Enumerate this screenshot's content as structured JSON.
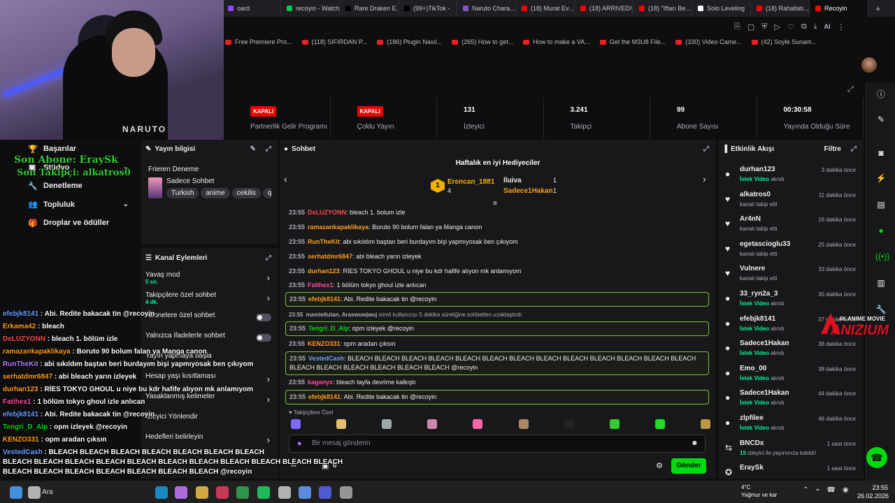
{
  "browser": {
    "tabs": [
      {
        "label": "oard",
        "color": "#9147ff"
      },
      {
        "label": "recoyin - Watch",
        "color": "#00c853"
      },
      {
        "label": "Rare Draken E...",
        "color": "#000000"
      },
      {
        "label": "(99+)TikTok -",
        "color": "#000000"
      },
      {
        "label": "Naruto Chara...",
        "color": "#7e57c2"
      },
      {
        "label": "(18) Murat Ev...",
        "color": "#ff0000"
      },
      {
        "label": "(18) ARRIVED!...",
        "color": "#ff0000"
      },
      {
        "label": "(18) \"Iftarı Be...",
        "color": "#ff0000"
      },
      {
        "label": "Solo Leveling",
        "color": "#ffffff"
      },
      {
        "label": "(18) Rahatlatı...",
        "color": "#ff0000"
      },
      {
        "label": "Recoyin",
        "color": "#ff0000",
        "active": true
      }
    ],
    "bookmarks": [
      "Free Premiere Pro...",
      "(118) SIFIRDAN P...",
      "(186) Plugin Nasıl...",
      "(265) How to get...",
      "How to make a VA...",
      "Get the M3U8 File...",
      "(330) Video Came...",
      "(42) Soyle Sunam..."
    ],
    "ai_label": "AI"
  },
  "stats": [
    {
      "value": "KAPALI",
      "label": "Partnerlik Gelir Programı",
      "badge": true
    },
    {
      "value": "KAPALI",
      "label": "Çoklu Yayın",
      "badge": true
    },
    {
      "value": "131",
      "label": "İzleyici"
    },
    {
      "value": "3.241",
      "label": "Takipçi"
    },
    {
      "value": "99",
      "label": "Abone Sayısı"
    },
    {
      "value": "00:30:58",
      "label": "Yayında Olduğu Süre"
    }
  ],
  "webcam": {
    "shirt_text": "NARUTO"
  },
  "leftnav": {
    "items": [
      {
        "label": "Başarılar",
        "icon": "trophy-icon",
        "glyph": "🏆"
      },
      {
        "label": "Stüdyo",
        "icon": "studio-icon",
        "glyph": "▣",
        "chev": true
      },
      {
        "label": "Denetleme",
        "icon": "wrench-icon",
        "glyph": "🔧"
      },
      {
        "label": "Topluluk",
        "icon": "users-icon",
        "glyph": "👥",
        "chev": true
      },
      {
        "label": "Droplar ve ödüller",
        "icon": "gift-icon",
        "glyph": "🎁"
      }
    ],
    "overlay_sub": "Son Abone: EraySk",
    "overlay_follow": "Son Takipçi: alkatros0"
  },
  "streaminfo": {
    "header": "Yayın bilgisi",
    "title": "Frieren Deneme",
    "category": "Sadece Sohbet",
    "tags": [
      "Turkish",
      "anime",
      "cekilis",
      "q"
    ]
  },
  "actions": {
    "header": "Kanal Eylemleri",
    "items": [
      {
        "label": "Yavaş mod",
        "sub": "5 sn.",
        "kind": "arrow"
      },
      {
        "label": "Takipçilere özel sohbet",
        "sub": "4 dk.",
        "kind": "arrow"
      },
      {
        "label": "Abonelere özel sohbet",
        "sub": "",
        "kind": "toggle"
      },
      {
        "label": "Yalnızca ifadelerle sohbet",
        "sub": "",
        "kind": "toggle"
      },
      {
        "label": "Yayın yapmaya başla",
        "sub": "",
        "kind": "none"
      },
      {
        "label": "Hesap yaşı kısıtlaması",
        "sub": "",
        "kind": "arrow"
      },
      {
        "label": "Yasaklanmış kelimeler",
        "sub": "",
        "kind": "arrow"
      },
      {
        "label": "İzleyici Yönlendir",
        "sub": "",
        "kind": "none"
      },
      {
        "label": "Hedefleri belirleyin",
        "sub": "",
        "kind": "arrow"
      }
    ]
  },
  "chat": {
    "header": "Sohbet",
    "gifters_title": "Haftalık en iyi Hediyeciler",
    "gifter1": {
      "rank": "1",
      "name": "Erencan_1881",
      "count": "4"
    },
    "gifter2": {
      "name": "lluiva",
      "count": "1"
    },
    "gifter3": {
      "name": "Sadece1Hakan",
      "count": "1"
    },
    "messages": [
      {
        "time": "23:55",
        "user": "DeLUZYONN",
        "color": "#ff4a4a",
        "text": ": bleach 1. bolum izle",
        "hl": false
      },
      {
        "time": "23:55",
        "user": "ramazankapaklikaya",
        "color": "#ff9f1a",
        "text": ": Boruto 90 bolum falan ya Manga canon",
        "hl": false
      },
      {
        "time": "23:55",
        "user": "RunTheKit",
        "color": "#ff9f1a",
        "text": ": abi sıkıldım baştan beri burdayım bişi yapmıyosak ben çıkıyom",
        "hl": false
      },
      {
        "time": "23:55",
        "user": "serhatdmr6847",
        "color": "#ff9f1a",
        "text": ": abi bleach yarın izleyek",
        "hl": false
      },
      {
        "time": "23:55",
        "user": "durhan123",
        "color": "#ff9f1a",
        "text": ": RİES TOKYO GHOUL u niye bu kdr hafife alıyon mk anlamıyom",
        "hl": false
      },
      {
        "time": "23:55",
        "user": "Fatihex1",
        "color": "#ff4a9a",
        "text": ": 1 bölüm tokyo ghoul izle anlıcan",
        "hl": false
      },
      {
        "time": "23:55",
        "user": "efebjk8141",
        "color": "#ff9f1a",
        "text": ": Abi. Redite bakacak tin @recoyin",
        "hl": true
      },
      {
        "time": "23:55",
        "user": "mamieltutan, Araswuwjwuj",
        "color": "#adadb8",
        "text": " isimli kullanıcıyı 5 dakika süreliğine sohbetten uzaklaştırdı",
        "hl": false
      },
      {
        "time": "23:55",
        "user": "Tengri_D_Alp",
        "color": "#00db10",
        "text": ": opm izleyek @recoyin",
        "hl": true
      },
      {
        "time": "23:55",
        "user": "KENZO331",
        "color": "#ff9f1a",
        "text": ": opm aradan çıksın",
        "hl": false
      },
      {
        "time": "23:55",
        "user": "VestedCash",
        "color": "#6a9fff",
        "text": ": BLEACH BLEACH BLEACH BLEACH BLEACH BLEACH BLEACH BLEACH BLEACH BLEACH BLEACH BLEACH BLEACH BLEACH BLEACH BLEACH BLEACH BLEACH BLEACH @recoyin",
        "hl": true
      },
      {
        "time": "23:55",
        "user": "kaganyx",
        "color": "#ff4a9a",
        "text": ": bleach tayfa devrime kalkıştı",
        "hl": false
      },
      {
        "time": "23:55",
        "user": "efebjk8141",
        "color": "#ff9f1a",
        "text": ": Abi. Redite bakacak tin @recoyin",
        "hl": true
      }
    ],
    "followers_only": "Takipçilere Özel",
    "input_placeholder": "Bir mesaj gönderin",
    "points": "0",
    "send_label": "Gönder"
  },
  "feed": {
    "header": "Etkinlik Akışı",
    "filter": "Filtre",
    "events": [
      {
        "name": "durhan123",
        "desc_pre": "",
        "desc_hl": "İstek Video",
        "desc_post": " alındı",
        "time": "3 dakika önce",
        "icon": "●"
      },
      {
        "name": "alkatros0",
        "desc_pre": "kanalı takip etti",
        "desc_hl": "",
        "desc_post": "",
        "time": "11 dakika önce",
        "icon": "♥"
      },
      {
        "name": "Ar4nN",
        "desc_pre": "kanalı takip etti",
        "desc_hl": "",
        "desc_post": "",
        "time": "16 dakika önce",
        "icon": "♥"
      },
      {
        "name": "egetascioglu33",
        "desc_pre": "kanalı takip etti",
        "desc_hl": "",
        "desc_post": "",
        "time": "25 dakika önce",
        "icon": "♥"
      },
      {
        "name": "Vulnere",
        "desc_pre": "kanalı takip etti",
        "desc_hl": "",
        "desc_post": "",
        "time": "33 dakika önce",
        "icon": "♥"
      },
      {
        "name": "33_ryn2a_3",
        "desc_pre": "",
        "desc_hl": "İstek Video",
        "desc_post": " alındı",
        "time": "35 dakika önce",
        "icon": "●"
      },
      {
        "name": "efebjk8141",
        "desc_pre": "",
        "desc_hl": "İstek Video",
        "desc_post": " alındı",
        "time": "37 dakika önce",
        "icon": "●"
      },
      {
        "name": "Sadece1Hakan",
        "desc_pre": "",
        "desc_hl": "İstek Video",
        "desc_post": " alındı",
        "time": "38 dakika önce",
        "icon": "●"
      },
      {
        "name": "Emo_00",
        "desc_pre": "",
        "desc_hl": "İstek Video",
        "desc_post": " alındı",
        "time": "38 dakika önce",
        "icon": "●"
      },
      {
        "name": "Sadece1Hakan",
        "desc_pre": "",
        "desc_hl": "İstek Video",
        "desc_post": " alındı",
        "time": "44 dakika önce",
        "icon": "●"
      },
      {
        "name": "zlpfilee",
        "desc_pre": "",
        "desc_hl": "İstek Video",
        "desc_post": " alındı",
        "time": "46 dakika önce",
        "icon": "●"
      },
      {
        "name": "BNCDx",
        "desc_pre": "",
        "desc_hl": "19",
        "desc_post": " izleyici ile yayınınıza katıldı!",
        "time": "1 saat önce",
        "icon": "⇆"
      },
      {
        "name": "EraySk",
        "desc_pre": "",
        "desc_hl": "",
        "desc_post": "",
        "time": "1 saat önce",
        "icon": "✪"
      }
    ]
  },
  "overlay_chat": [
    {
      "user": "efebjk8141",
      "color": "#6a9fff",
      "text": " : Abi. Redite bakacak tin @recoyin"
    },
    {
      "user": "Erkama42",
      "color": "#ff9f1a",
      "text": " : bleach"
    },
    {
      "user": "DeLUZYONN",
      "color": "#ff4a4a",
      "text": " : bleach 1. bölüm izle"
    },
    {
      "user": "ramazankapaklikaya",
      "color": "#ff9f1a",
      "text": " : Boruto 90 bolum falan ya Manga canon"
    },
    {
      "user": "RunTheKit",
      "color": "#b57aff",
      "text": " : abi sıkıldım baştan beri burdayım bişi yapmıyosak ben çıkıyom"
    },
    {
      "user": "serhatdmr6847",
      "color": "#ff9f1a",
      "text": " : abi bleach yarın izleyek"
    },
    {
      "user": "durhan123",
      "color": "#ff9f1a",
      "text": " : RİES TOKYO GHOUL u niye bu kdr hafife alıyon mk anlamıyom"
    },
    {
      "user": "Fatihex1",
      "color": "#ff4a9a",
      "text": " : 1 bölüm tokyo ghoul izle anlıcan"
    },
    {
      "user": "efebjk8141",
      "color": "#6a9fff",
      "text": " : Abi. Redite bakacak tin @recoyin"
    },
    {
      "user": "Tengri_D_Alp",
      "color": "#00db10",
      "text": " : opm izleyek @recoyin"
    },
    {
      "user": "KENZO331",
      "color": "#ff9f1a",
      "text": " : opm aradan çıksın"
    },
    {
      "user": "VestedCash",
      "color": "#6a9fff",
      "text": " : BLEACH BLEACH BLEACH BLEACH BLEACH BLEACH BLEACH"
    },
    {
      "user": "",
      "color": "#ffffff",
      "text": "BLEACH BLEACH BLEACH BLEACH BLEACH BLEACH BLEACH BLEACH BLEACH BLEACH BLEACH"
    },
    {
      "user": "",
      "color": "#ffffff",
      "text": "BLEACH BLEACH BLEACH BLEACH BLEACH BLEACH BLEACH @recoyin"
    },
    {
      "user": "kaganyx",
      "color": "#ff4a9a",
      "text": " : bleach tayfa devrime kalkıştı"
    },
    {
      "user": "efebjk8141",
      "color": "#6a9fff",
      "text": " : Abi. Redite bakacak tin @recoyin"
    }
  ],
  "overlay_logo": {
    "small": "4K ANIME MOVIE",
    "big": "ANIZIUM"
  },
  "taskbar": {
    "search": "Ara",
    "weather_temp": "4°C",
    "weather_desc": "Yağmur ve kar",
    "time": "23:55",
    "date": "26.02.2026"
  }
}
